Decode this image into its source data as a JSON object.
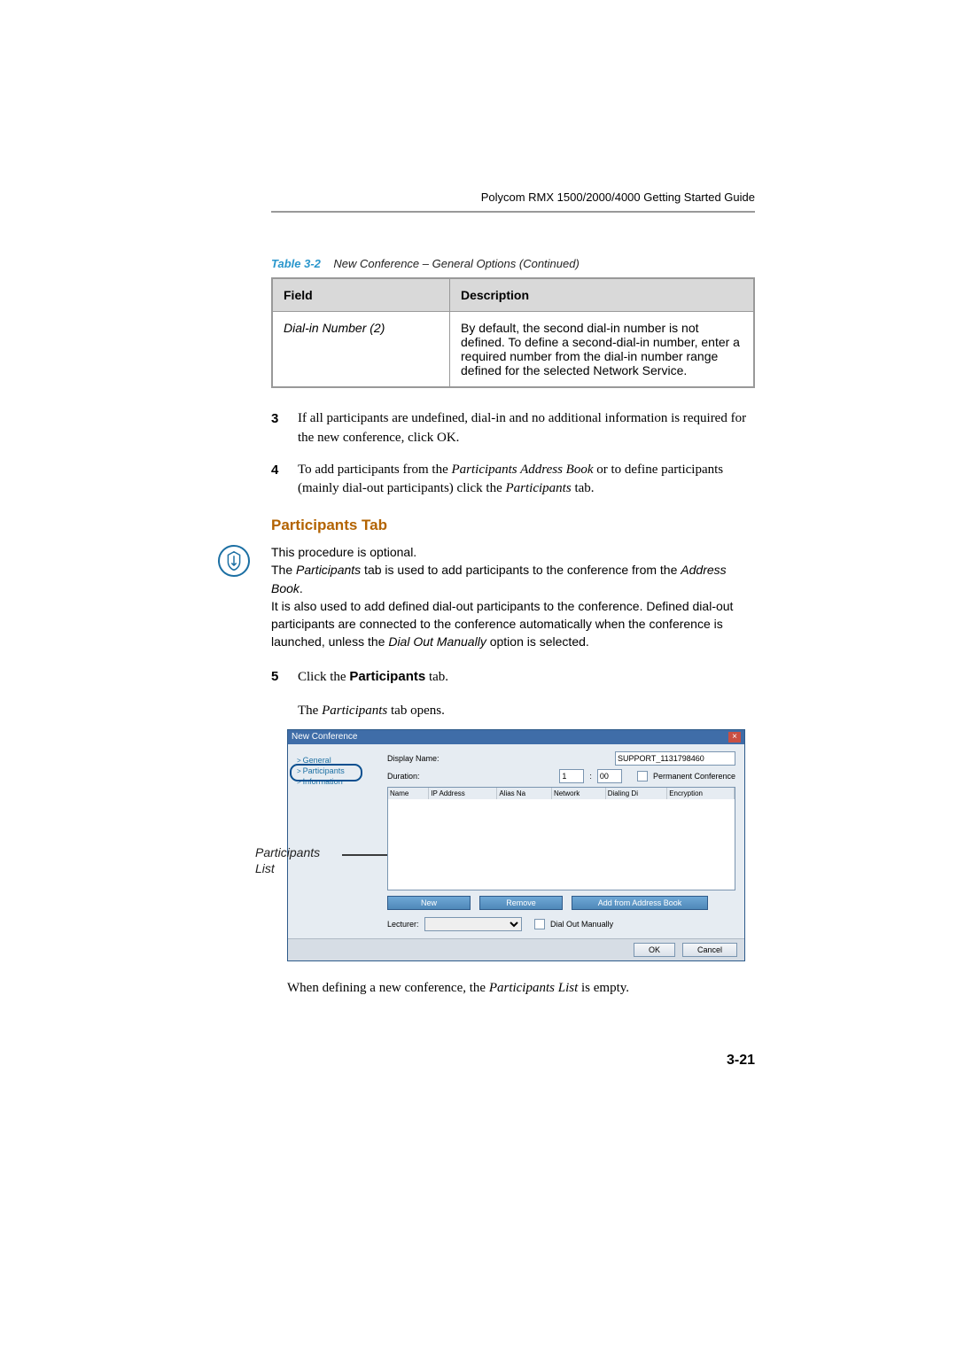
{
  "header": {
    "running": "Polycom RMX 1500/2000/4000 Getting Started Guide"
  },
  "table": {
    "caption_label": "Table 3-2",
    "caption_text": "New Conference – General Options (Continued)",
    "head_field": "Field",
    "head_desc": "Description",
    "row_field": "Dial-in Number (2)",
    "row_desc": "By default, the second dial-in number is not defined. To define a second-dial-in number, enter a required number from the dial-in number range defined for the selected Network Service."
  },
  "steps": {
    "s3_num": "3",
    "s3_text": "If all participants are undefined, dial-in and no additional information is required for the new conference, click OK.",
    "s4_num": "4",
    "s4_a": "To add participants from the ",
    "s4_b": "Participants Address Book",
    "s4_c": " or to define participants (mainly dial-out participants) click the ",
    "s4_d": "Participants",
    "s4_e": " tab.",
    "s5_num": "5",
    "s5_a": "Click the ",
    "s5_b": "Participants",
    "s5_c": " tab.",
    "s5_sub_a": "The ",
    "s5_sub_b": "Participants",
    "s5_sub_c": " tab opens."
  },
  "heading": "Participants Tab",
  "note": {
    "l1": "This procedure is optional.",
    "l2a": "The ",
    "l2b": "Participants",
    "l2c": " tab is used to add participants to the conference from the ",
    "l2d": "Address Book",
    "l2e": ".",
    "l3a": "It is also used to add defined dial-out participants to the conference. Defined dial-out participants are connected to the conference automatically when the conference is launched, unless the ",
    "l3b": "Dial Out Manually",
    "l3c": " option is selected."
  },
  "annot": {
    "l1": "Participants",
    "l2": "List"
  },
  "dialog": {
    "title": "New Conference",
    "tree": {
      "general": "General",
      "participants": "Participants",
      "information": "Information"
    },
    "display_name_label": "Display Name:",
    "display_name_value": "SUPPORT_1131798460",
    "duration_label": "Duration:",
    "duration_h": "1",
    "duration_sep": ":",
    "duration_m": "00",
    "perm_conf": "Permanent Conference",
    "cols": {
      "name": "Name",
      "ip": "IP Address",
      "alias": "Alias Na",
      "network": "Network",
      "dialing": "Dialing Di",
      "enc": "Encryption"
    },
    "btn_new": "New",
    "btn_remove": "Remove",
    "btn_add": "Add from Address Book",
    "lecturer_label": "Lecturer:",
    "dial_out": "Dial Out Manually",
    "ok": "OK",
    "cancel": "Cancel"
  },
  "after_shot_a": "When defining a new conference, the ",
  "after_shot_b": "Participants List",
  "after_shot_c": " is empty.",
  "page_num": "3-21"
}
